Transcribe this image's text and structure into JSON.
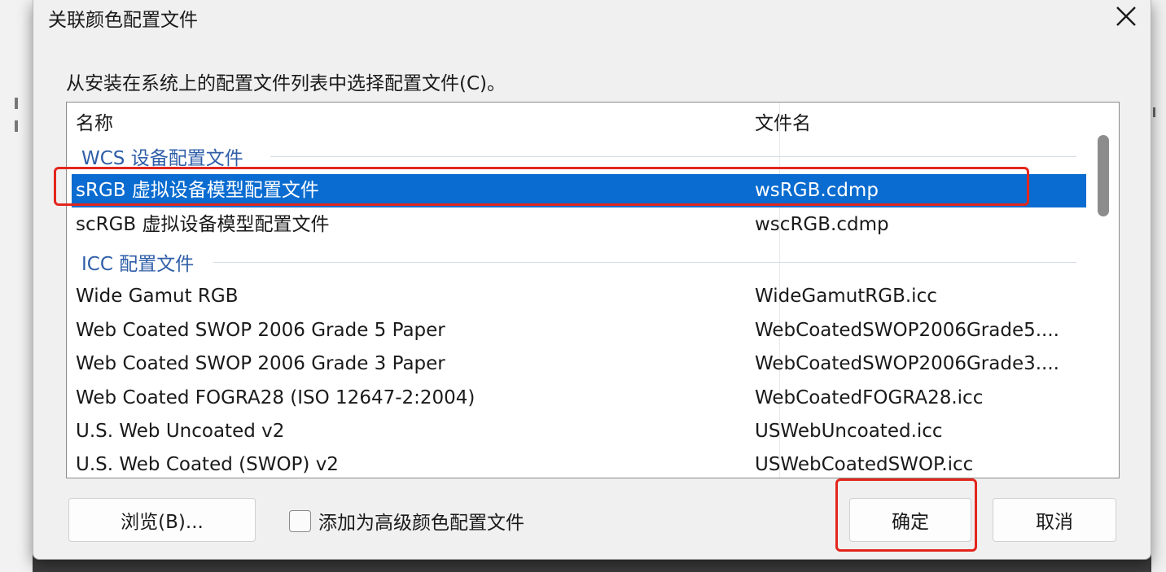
{
  "dialog": {
    "title": "关联颜色配置文件",
    "close_icon": "close-icon",
    "instruction": "从安装在系统上的配置文件列表中选择配置文件(C)。"
  },
  "list": {
    "columns": {
      "name": "名称",
      "filename": "文件名"
    },
    "groups": [
      {
        "label": "WCS 设备配置文件",
        "rows": [
          {
            "name": "sRGB 虚拟设备模型配置文件",
            "filename": "wsRGB.cdmp",
            "selected": true
          },
          {
            "name": "scRGB 虚拟设备模型配置文件",
            "filename": "wscRGB.cdmp",
            "selected": false
          }
        ]
      },
      {
        "label": "ICC 配置文件",
        "rows": [
          {
            "name": "Wide Gamut RGB",
            "filename": "WideGamutRGB.icc"
          },
          {
            "name": "Web Coated SWOP 2006 Grade 5 Paper",
            "filename": "WebCoatedSWOP2006Grade5...."
          },
          {
            "name": "Web Coated SWOP 2006 Grade 3 Paper",
            "filename": "WebCoatedSWOP2006Grade3...."
          },
          {
            "name": "Web Coated FOGRA28 (ISO 12647-2:2004)",
            "filename": "WebCoatedFOGRA28.icc"
          },
          {
            "name": "U.S. Web Uncoated v2",
            "filename": "USWebUncoated.icc"
          },
          {
            "name": "U.S. Web Coated (SWOP) v2",
            "filename": "USWebCoatedSWOP.icc"
          }
        ]
      }
    ]
  },
  "footer": {
    "browse_label": "浏览(B)...",
    "advanced_checkbox_label": "添加为高级颜色配置文件",
    "advanced_checked": false,
    "ok_label": "确定",
    "cancel_label": "取消"
  },
  "colors": {
    "selection": "#0a6cd0",
    "group_header": "#2f5ea8",
    "annotation_box": "#e3261d"
  }
}
